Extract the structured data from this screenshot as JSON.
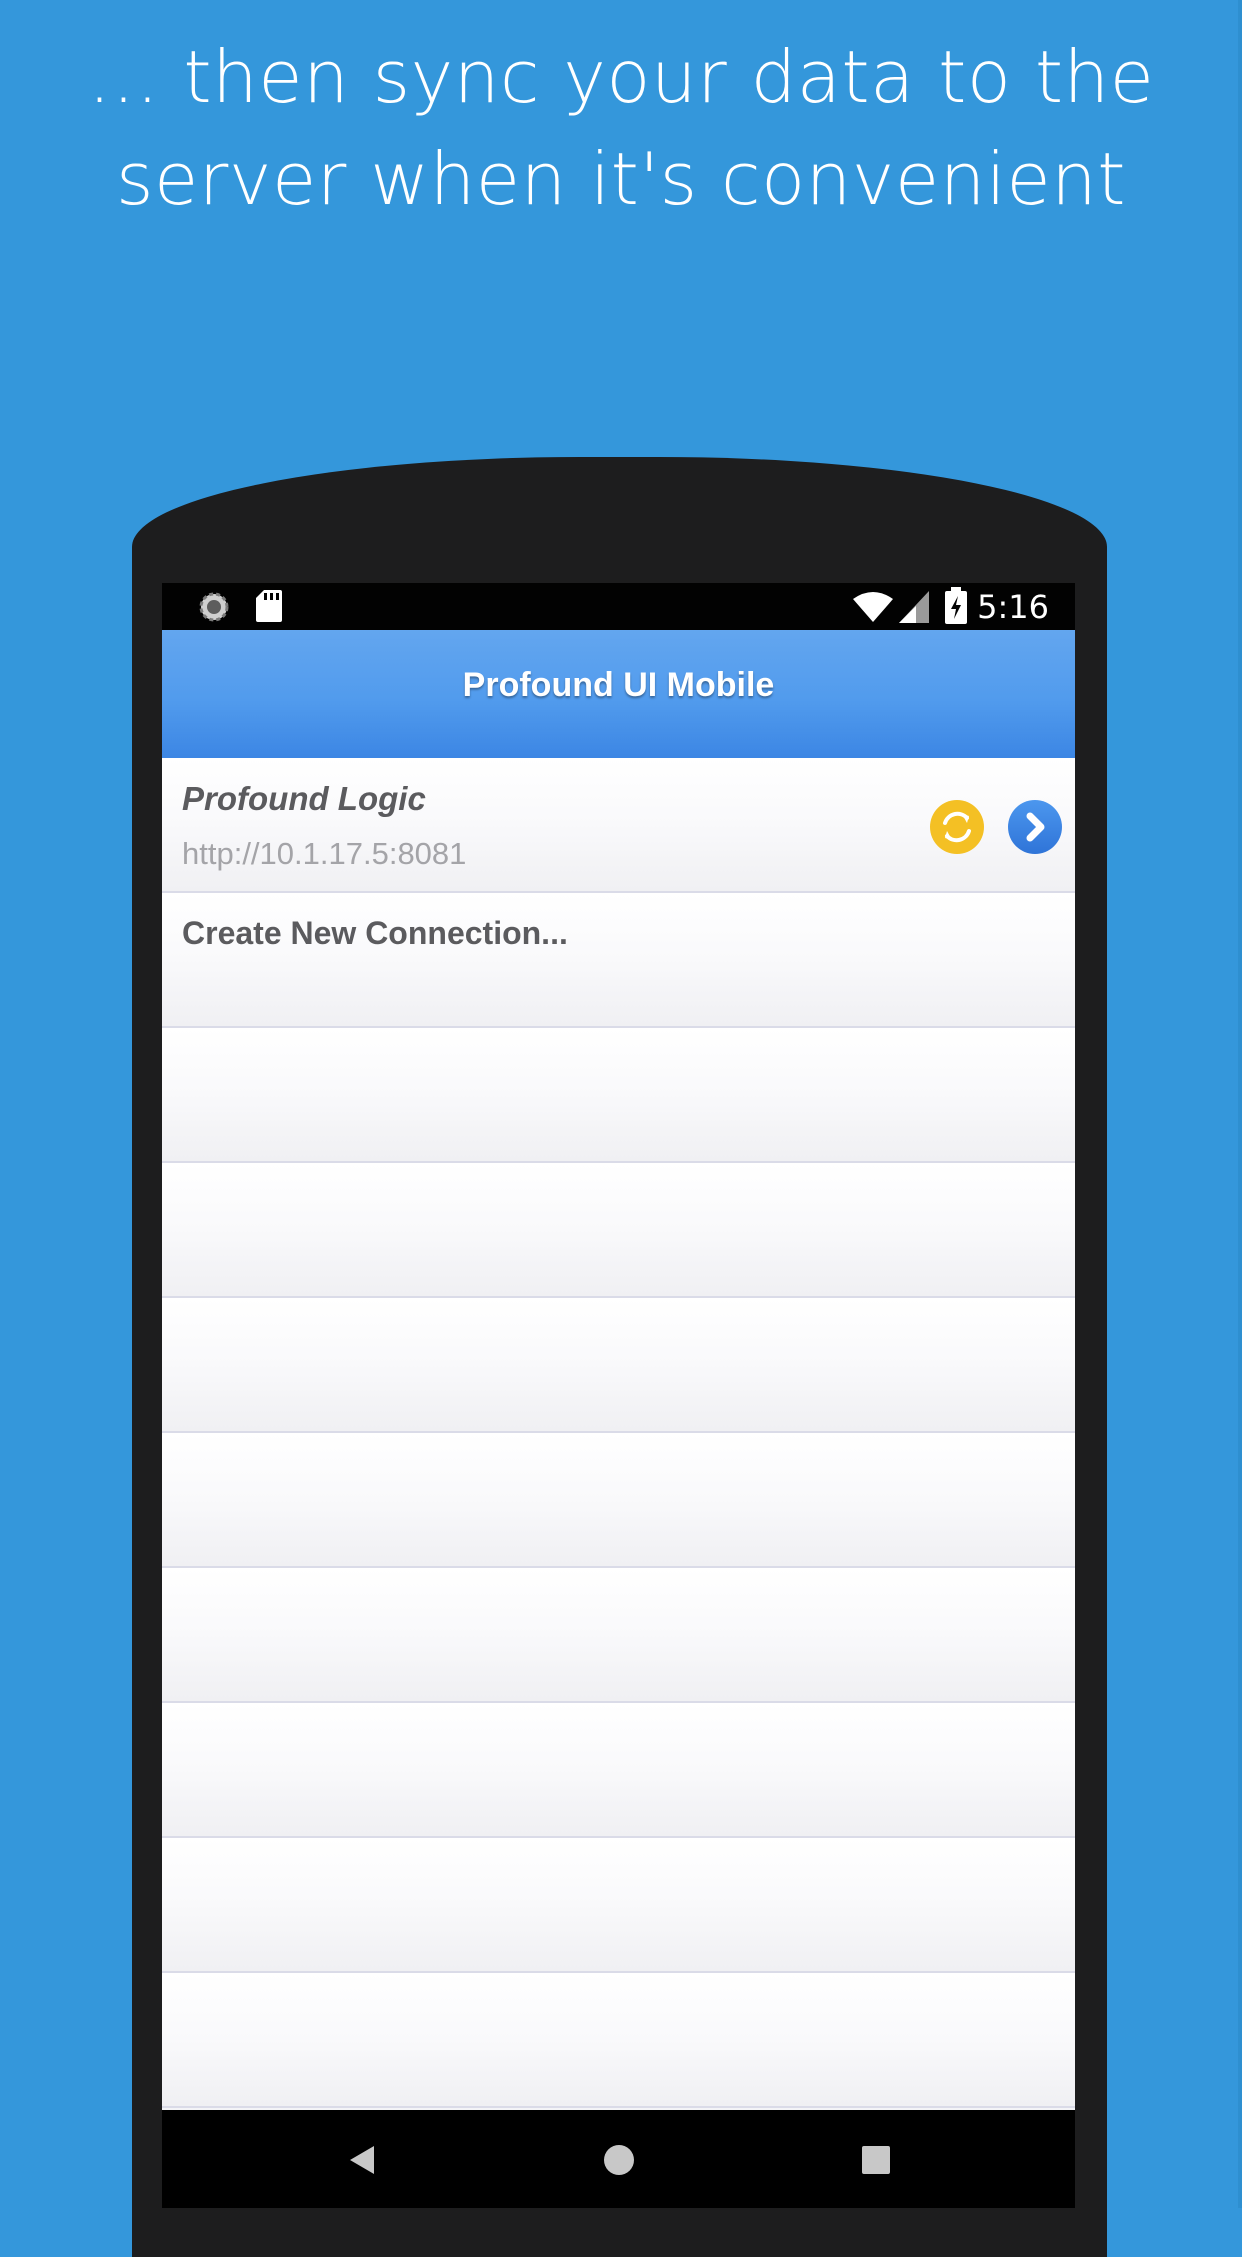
{
  "headline": {
    "line1": "… then sync your data to the",
    "line2": "server when it's convenient"
  },
  "status_bar": {
    "time": "5:16",
    "icons": [
      "sync-icon",
      "sd-card-icon",
      "wifi-icon",
      "cell-signal-icon",
      "battery-charging-icon"
    ]
  },
  "app": {
    "title": "Profound UI Mobile"
  },
  "connections": [
    {
      "name": "Profound Logic",
      "url": "http://10.1.17.5:8081",
      "actions": [
        "sync-icon",
        "chevron-right-icon"
      ]
    }
  ],
  "create_connection_label": "Create New Connection...",
  "empty_rows": 8,
  "nav_bar": {
    "buttons": [
      "back-icon",
      "home-icon",
      "recent-apps-icon"
    ]
  },
  "colors": {
    "background": "#3497DB",
    "phone_frame": "#1D1D1E",
    "header_top": "#63A6EF",
    "header_bottom": "#3C86E4",
    "sync_button": "#F4C024",
    "go_button": "#3A84E2",
    "row_divider": "#DADBE8"
  }
}
